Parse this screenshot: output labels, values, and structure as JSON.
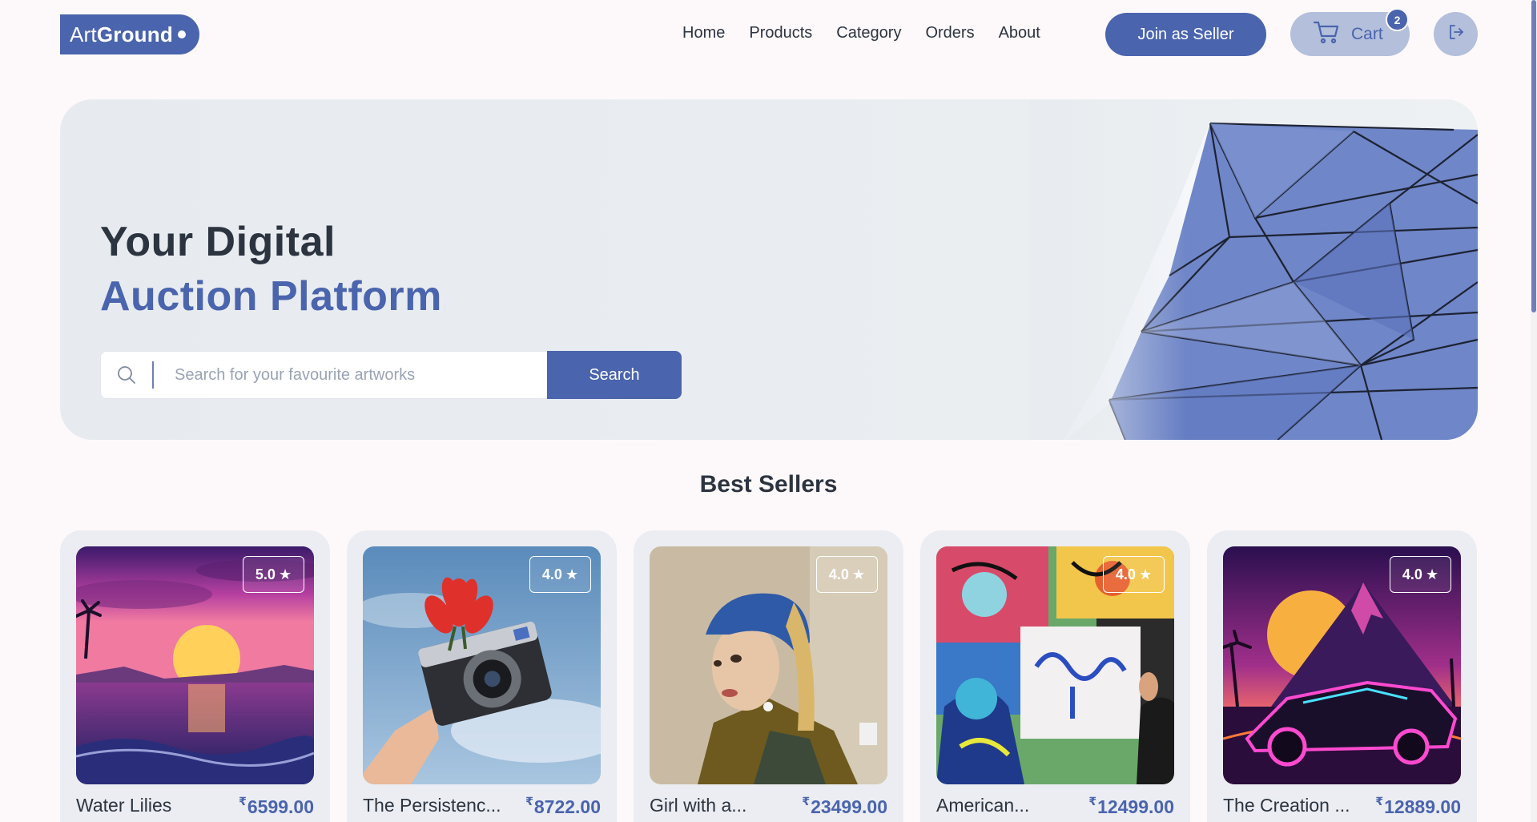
{
  "brand": {
    "name_light": "Art",
    "name_bold": "Ground",
    "color": "#4a64ad"
  },
  "nav": {
    "items": [
      {
        "label": "Home"
      },
      {
        "label": "Products"
      },
      {
        "label": "Category"
      },
      {
        "label": "Orders"
      },
      {
        "label": "About"
      }
    ],
    "seller_button": "Join as Seller",
    "cart": {
      "label": "Cart",
      "count": "2",
      "icon": "cart-icon"
    },
    "logout_icon": "logout-icon"
  },
  "hero": {
    "title_line1": "Your Digital",
    "title_line2": "Auction Platform",
    "search": {
      "placeholder": "Search for your favourite artworks",
      "value": "",
      "button_label": "Search"
    }
  },
  "best_sellers": {
    "title": "Best Sellers",
    "currency": "₹",
    "items": [
      {
        "name": "Water Lilies",
        "price": "6599.00",
        "rating": "5.0"
      },
      {
        "name": "The Persistenc...",
        "price": "8722.00",
        "rating": "4.0"
      },
      {
        "name": "Girl with a...",
        "price": "23499.00",
        "rating": "4.0"
      },
      {
        "name": "American...",
        "price": "12499.00",
        "rating": "4.0"
      },
      {
        "name": "The Creation ...",
        "price": "12889.00",
        "rating": "4.0"
      }
    ]
  },
  "colors": {
    "accent": "#4a64ad",
    "accent_light": "#b3bfdb",
    "text": "#2c3440"
  }
}
